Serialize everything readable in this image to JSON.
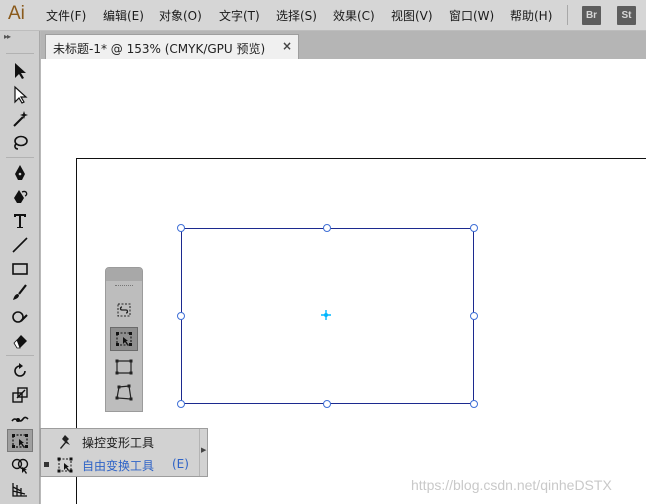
{
  "app": {
    "logo": "Ai"
  },
  "menu": {
    "items": [
      "文件(F)",
      "编辑(E)",
      "对象(O)",
      "文字(T)",
      "选择(S)",
      "效果(C)",
      "视图(V)",
      "窗口(W)",
      "帮助(H)"
    ]
  },
  "app_buttons": [
    "Br",
    "St"
  ],
  "document": {
    "tab_title": "未标题-1* @ 153% (CMYK/GPU 预览)",
    "close_glyph": "×"
  },
  "toolbar": {
    "grip": "▸▸",
    "tools": [
      "selection-tool",
      "direct-selection-tool",
      "magic-wand-tool",
      "lasso-tool",
      "pen-tool",
      "curvature-tool",
      "type-tool",
      "line-segment-tool",
      "rectangle-tool",
      "paintbrush-tool",
      "shaper-tool",
      "eraser-tool",
      "rotate-tool",
      "scale-tool",
      "width-tool",
      "free-transform-tool",
      "shape-builder-tool",
      "perspective-grid-tool"
    ]
  },
  "flyout": {
    "items": [
      {
        "label": "操控变形工具",
        "shortcut": "",
        "icon": "puppet-warp-icon",
        "selected": false
      },
      {
        "label": "自由变换工具",
        "shortcut": "(E)",
        "icon": "free-transform-icon",
        "selected": true
      }
    ]
  },
  "mini_panel": {
    "tools": [
      "constrain-icon",
      "free-transform-icon",
      "perspective-distort-icon",
      "free-distort-icon"
    ]
  },
  "colors": {
    "selection": "#1c2a8f",
    "handle": "#3f6fd6",
    "center": "#00b7ff",
    "highlight": "#2e63c7"
  },
  "watermark": "https://blog.csdn.net/qinheDSTX"
}
